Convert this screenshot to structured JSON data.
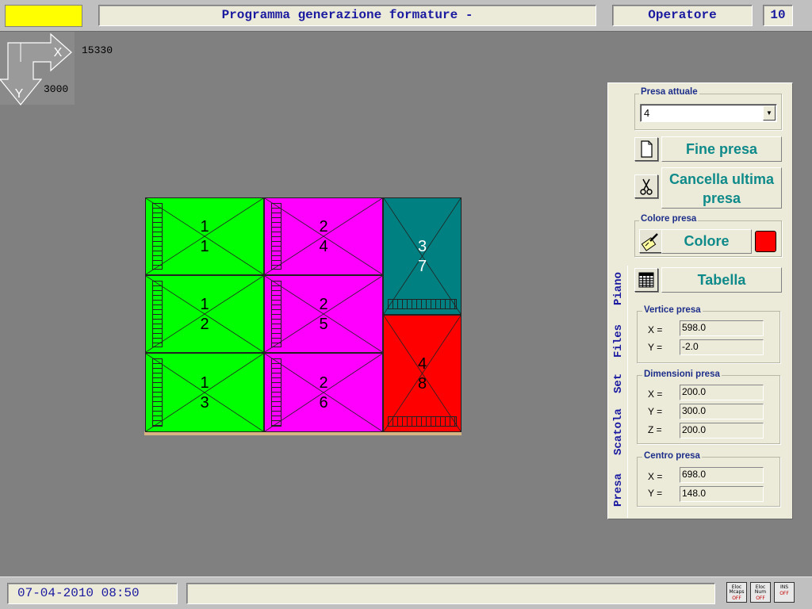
{
  "header": {
    "status_color": "#ffff00",
    "title": "Programma generazione formature -",
    "role": "Operatore",
    "number": "10"
  },
  "axes": {
    "x_label": "X",
    "y_label": "Y",
    "x_value": "15330",
    "y_value": "3000"
  },
  "boxes": [
    {
      "layer": "1",
      "index": "1",
      "color": "#00ff00",
      "text_color": "#000000"
    },
    {
      "layer": "1",
      "index": "2",
      "color": "#00ff00",
      "text_color": "#000000"
    },
    {
      "layer": "1",
      "index": "3",
      "color": "#00ff00",
      "text_color": "#000000"
    },
    {
      "layer": "2",
      "index": "4",
      "color": "#ff00ff",
      "text_color": "#000000"
    },
    {
      "layer": "2",
      "index": "5",
      "color": "#ff00ff",
      "text_color": "#000000"
    },
    {
      "layer": "2",
      "index": "6",
      "color": "#ff00ff",
      "text_color": "#000000"
    },
    {
      "layer": "3",
      "index": "7",
      "color": "#008080",
      "text_color": "#ffffff"
    },
    {
      "layer": "4",
      "index": "8",
      "color": "#ff0000",
      "text_color": "#000000"
    }
  ],
  "panel": {
    "presa_attuale_label": "Presa attuale",
    "presa_attuale_value": "4",
    "fine_presa": "Fine presa",
    "cancella_ultima": "Cancella ultima presa",
    "colore_presa_label": "Colore presa",
    "colore_button": "Colore",
    "colore_swatch": "#ff0000",
    "tabella": "Tabella",
    "vertice": {
      "label": "Vertice presa",
      "x_label": "X =",
      "x": "598.0",
      "y_label": "Y =",
      "y": "-2.0"
    },
    "dimensioni": {
      "label": "Dimensioni presa",
      "x_label": "X =",
      "x": "200.0",
      "y_label": "Y =",
      "y": "300.0",
      "z_label": "Z =",
      "z": "200.0"
    },
    "centro": {
      "label": "Centro presa",
      "x_label": "X =",
      "x": "698.0",
      "y_label": "Y =",
      "y": "148.0"
    }
  },
  "tabs": [
    "Piano",
    "Files",
    "Set",
    "Scatola",
    "Presa"
  ],
  "footer": {
    "datetime": "07-04-2010 08:50",
    "status_message": "",
    "indicators": [
      {
        "top": "Eloc",
        "mid": "Mcaps",
        "state": "OFF"
      },
      {
        "top": "Eloc",
        "mid": "Num",
        "state": "OFF"
      },
      {
        "top": "INS",
        "mid": "",
        "state": "OFF"
      }
    ]
  }
}
